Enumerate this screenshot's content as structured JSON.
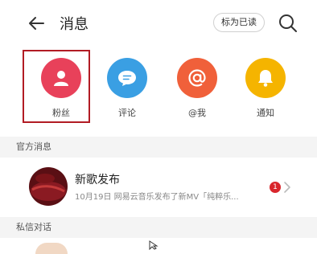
{
  "header": {
    "title": "消息",
    "mark_read_label": "标为已读",
    "back_icon": "back-arrow-icon",
    "search_icon": "search-icon"
  },
  "categories": [
    {
      "label": "粉丝",
      "icon": "person-icon",
      "color": "#e8415a"
    },
    {
      "label": "评论",
      "icon": "comment-bubble-icon",
      "color": "#3a9fe3"
    },
    {
      "label": "@我",
      "icon": "at-icon",
      "color": "#f0603a"
    },
    {
      "label": "通知",
      "icon": "bell-icon",
      "color": "#f5b400"
    }
  ],
  "sections": {
    "official": "官方消息",
    "private": "私信对话"
  },
  "official_message": {
    "title": "新歌发布",
    "preview": "10月19日 网易云音乐发布了新MV「纯粹乐...",
    "unread_count": "1"
  },
  "colors": {
    "highlight": "#b21c24",
    "badge": "#d9262c",
    "section_bg": "#f4f4f4"
  }
}
